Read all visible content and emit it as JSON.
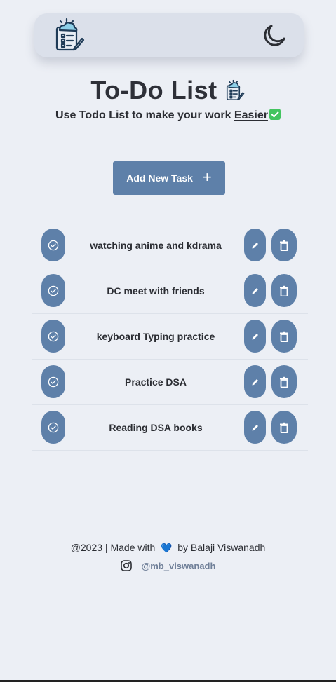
{
  "header": {
    "logo_icon": "clipboard-cloud-icon",
    "theme_toggle_icon": "moon-icon"
  },
  "hero": {
    "title": "To-Do List",
    "subtitle_prefix": "Use Todo List to make your work ",
    "subtitle_link": "Easier",
    "subtitle_emoji": "check-mark-button-emoji"
  },
  "add_task": {
    "label": "Add New Task",
    "icon": "plus-icon"
  },
  "tasks": [
    {
      "text": "watching anime and kdrama"
    },
    {
      "text": "DC meet with friends"
    },
    {
      "text": "keyboard Typing practice"
    },
    {
      "text": "Practice DSA"
    },
    {
      "text": "Reading DSA books"
    }
  ],
  "footer": {
    "prefix": "@2023 | Made with",
    "heart": "💙",
    "suffix": "by Balaji Viswanadh",
    "social_icon": "instagram-icon",
    "handle": "@mb_viswanadh"
  },
  "colors": {
    "background": "#eceff5",
    "accent": "#5e80a9",
    "navbar": "#dbe0ea"
  }
}
